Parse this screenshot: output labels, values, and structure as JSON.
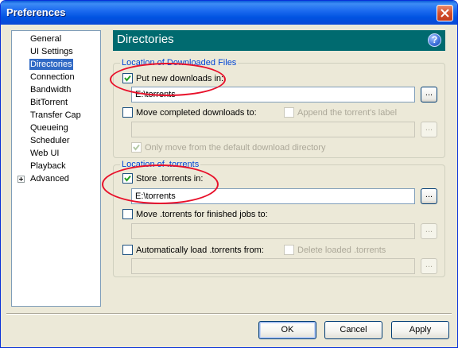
{
  "window": {
    "title": "Preferences"
  },
  "nav": {
    "items": [
      {
        "label": "General",
        "selected": false
      },
      {
        "label": "UI Settings",
        "selected": false
      },
      {
        "label": "Directories",
        "selected": true
      },
      {
        "label": "Connection",
        "selected": false
      },
      {
        "label": "Bandwidth",
        "selected": false
      },
      {
        "label": "BitTorrent",
        "selected": false
      },
      {
        "label": "Transfer Cap",
        "selected": false
      },
      {
        "label": "Queueing",
        "selected": false
      },
      {
        "label": "Scheduler",
        "selected": false
      },
      {
        "label": "Web UI",
        "selected": false
      },
      {
        "label": "Playback",
        "selected": false
      },
      {
        "label": "Advanced",
        "selected": false,
        "expandable": true
      }
    ]
  },
  "header": {
    "title": "Directories",
    "help_glyph": "?"
  },
  "downloaded_files": {
    "legend": "Location of Downloaded Files",
    "put_new_downloads": {
      "label": "Put new downloads in:",
      "checked": true,
      "path": "E:\\torrents"
    },
    "move_completed": {
      "label": "Move completed downloads to:",
      "checked": false,
      "path": ""
    },
    "append_label": {
      "label": "Append the torrent's label",
      "checked": false,
      "enabled": false
    },
    "only_move_default": {
      "label": "Only move from the default download directory",
      "checked": true,
      "enabled": false
    }
  },
  "torrents": {
    "legend": "Location of .torrents",
    "store_torrents": {
      "label": "Store .torrents in:",
      "checked": true,
      "path": "E:\\torrents"
    },
    "move_finished": {
      "label": "Move .torrents for finished jobs to:",
      "checked": false,
      "path": ""
    },
    "auto_load": {
      "label": "Automatically load .torrents from:",
      "checked": false,
      "path": ""
    },
    "delete_loaded": {
      "label": "Delete loaded .torrents",
      "checked": false,
      "enabled": false
    }
  },
  "browse_label": "...",
  "buttons": {
    "ok": "OK",
    "cancel": "Cancel",
    "apply": "Apply"
  },
  "colors": {
    "header_bg": "#006a6f",
    "selection": "#316ac5",
    "annotation_circle": "#e8102a",
    "legend_text": "#0046d5"
  }
}
